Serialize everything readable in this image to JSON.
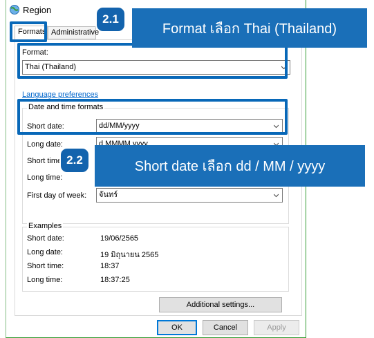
{
  "window": {
    "title": "Region"
  },
  "tabs": [
    {
      "label": "Formats"
    },
    {
      "label": "Administrative"
    }
  ],
  "format": {
    "label": "Format:",
    "value": "Thai (Thailand)"
  },
  "language_link": "Language preferences",
  "datetime_group": {
    "title": "Date and time formats",
    "rows": [
      {
        "label": "Short date:",
        "value": "dd/MM/yyyy"
      },
      {
        "label": "Long date:",
        "value": "d MMMM yyyy"
      },
      {
        "label": "Short time:",
        "value": ""
      },
      {
        "label": "Long time:",
        "value": ""
      },
      {
        "label": "First day of week:",
        "value": "จันทร์"
      }
    ]
  },
  "examples": {
    "title": "Examples",
    "rows": [
      {
        "label": "Short date:",
        "value": "19/06/2565"
      },
      {
        "label": "Long date:",
        "value": "19 มิถุนายน 2565"
      },
      {
        "label": "Short time:",
        "value": "18:37"
      },
      {
        "label": "Long time:",
        "value": "18:37:25"
      }
    ]
  },
  "buttons": {
    "additional": "Additional settings...",
    "ok": "OK",
    "cancel": "Cancel",
    "apply": "Apply"
  },
  "annotations": {
    "step1": {
      "badge": "2.1",
      "text": "Format เลือก Thai (Thailand)"
    },
    "step2": {
      "badge": "2.2",
      "text": "Short date เลือก dd / MM / yyyy"
    }
  },
  "colors": {
    "highlight": "#0868b8",
    "callout": "#1a6fb8",
    "link": "#0066cc",
    "ok_border": "#0078d7"
  }
}
